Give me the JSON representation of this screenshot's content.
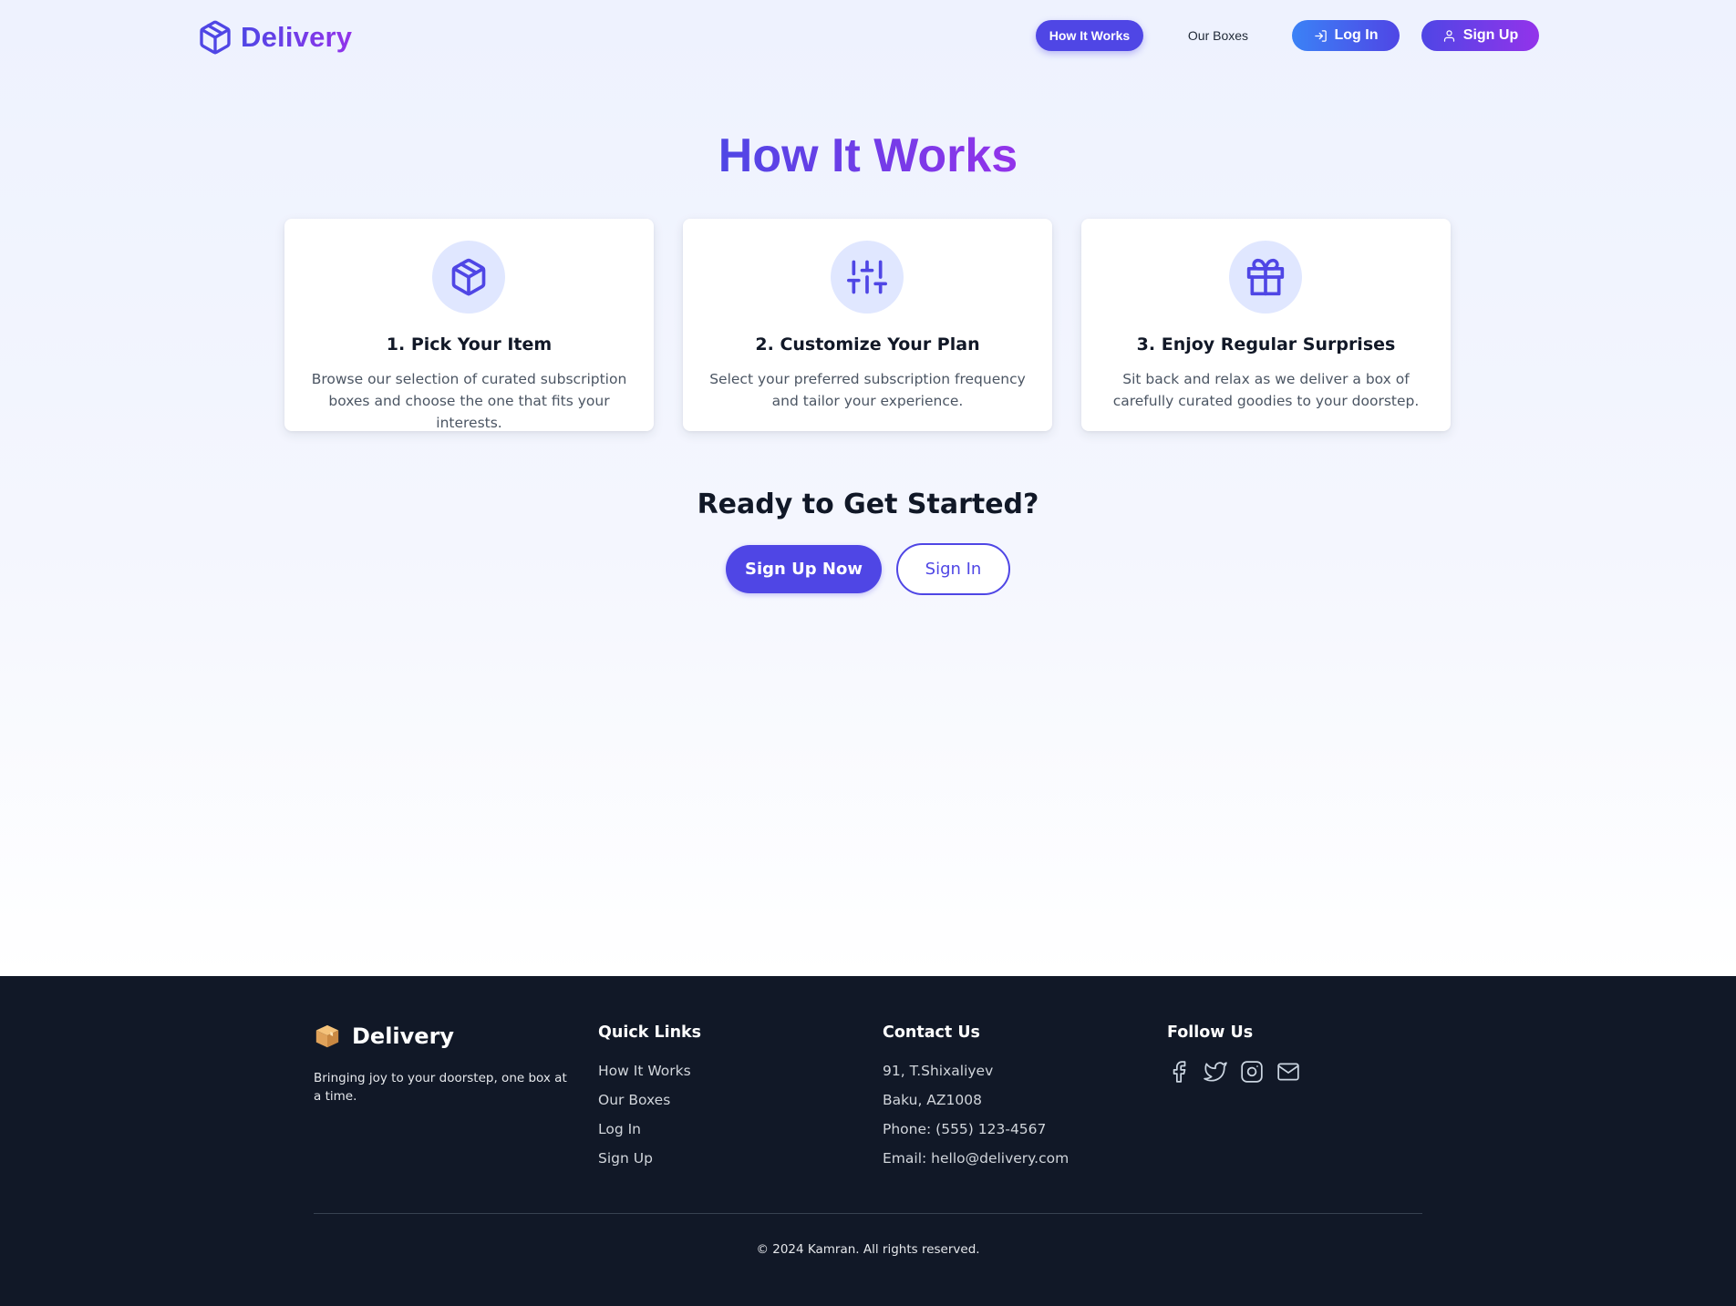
{
  "header": {
    "brand": "Delivery",
    "nav": {
      "how_it_works": "How It Works",
      "our_boxes": "Our Boxes",
      "log_in": "Log In",
      "sign_up": "Sign Up"
    }
  },
  "main": {
    "title": "How It Works",
    "steps": [
      {
        "icon": "package-icon",
        "title": "1. Pick Your Item",
        "text": "Browse our selection of curated subscription boxes and choose the one that fits your interests."
      },
      {
        "icon": "sliders-icon",
        "title": "2. Customize Your Plan",
        "text": "Select your preferred subscription frequency and tailor your experience."
      },
      {
        "icon": "gift-icon",
        "title": "3. Enjoy Regular Surprises",
        "text": "Sit back and relax as we deliver a box of carefully curated goodies to your doorstep."
      }
    ],
    "cta": {
      "title": "Ready to Get Started?",
      "primary": "Sign Up Now",
      "secondary": "Sign In"
    }
  },
  "footer": {
    "brand": "Delivery",
    "tagline": "Bringing joy to your doorstep, one box at a time.",
    "quick_links": {
      "heading": "Quick Links",
      "items": [
        "How It Works",
        "Our Boxes",
        "Log In",
        "Sign Up"
      ]
    },
    "contact": {
      "heading": "Contact Us",
      "items": [
        "91, T.Shixaliyev",
        "Baku, AZ1008",
        "Phone: (555) 123-4567",
        "Email: hello@delivery.com"
      ]
    },
    "follow": {
      "heading": "Follow Us",
      "icons": [
        "facebook-icon",
        "twitter-icon",
        "instagram-icon",
        "mail-icon"
      ]
    },
    "copyright": "© 2024 Kamran. All rights reserved."
  },
  "colors": {
    "primary": "#4f46e5",
    "accent_purple": "#9333ea",
    "accent_blue": "#3b82f6",
    "footer_bg": "#111827",
    "icon_circle_bg": "#e0e7ff"
  }
}
